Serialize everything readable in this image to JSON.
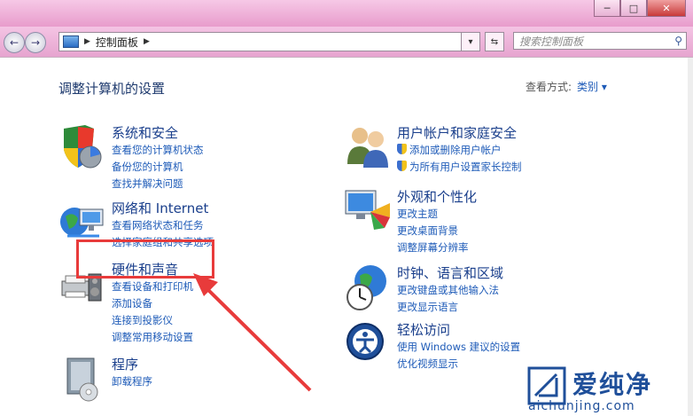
{
  "window": {
    "buttons": {
      "minimize": "─",
      "maximize": "□",
      "close": "✕"
    }
  },
  "nav": {
    "back": "←",
    "forward": "→",
    "breadcrumb": "控制面板",
    "search_placeholder": "搜索控制面板"
  },
  "header": {
    "title": "调整计算机的设置",
    "view_label": "查看方式:",
    "view_value": "类别 ▾"
  },
  "categories": [
    {
      "title": "系统和安全",
      "links": [
        "查看您的计算机状态",
        "备份您的计算机",
        "查找并解决问题"
      ]
    },
    {
      "title": "网络和 Internet",
      "links": [
        "查看网络状态和任务",
        "选择家庭组和共享选项"
      ]
    },
    {
      "title": "硬件和声音",
      "links": [
        "查看设备和打印机",
        "添加设备",
        "连接到投影仪",
        "调整常用移动设置"
      ]
    },
    {
      "title": "程序",
      "links": [
        "卸载程序"
      ]
    },
    {
      "title": "用户帐户和家庭安全",
      "links": [
        "添加或删除用户帐户",
        "为所有用户设置家长控制"
      ]
    },
    {
      "title": "外观和个性化",
      "links": [
        "更改主题",
        "更改桌面背景",
        "调整屏幕分辨率"
      ]
    },
    {
      "title": "时钟、语言和区域",
      "links": [
        "更改键盘或其他输入法",
        "更改显示语言"
      ]
    },
    {
      "title": "轻松访问",
      "links": [
        "使用 Windows 建议的设置",
        "优化视频显示"
      ]
    }
  ],
  "watermark": {
    "text": "爱纯净",
    "url": "aichunjing.com"
  },
  "colors": {
    "titlebar": "#eaa6d2",
    "link": "#1e5bb8",
    "title": "#1a3f8c",
    "annotation": "#e83b3b"
  }
}
